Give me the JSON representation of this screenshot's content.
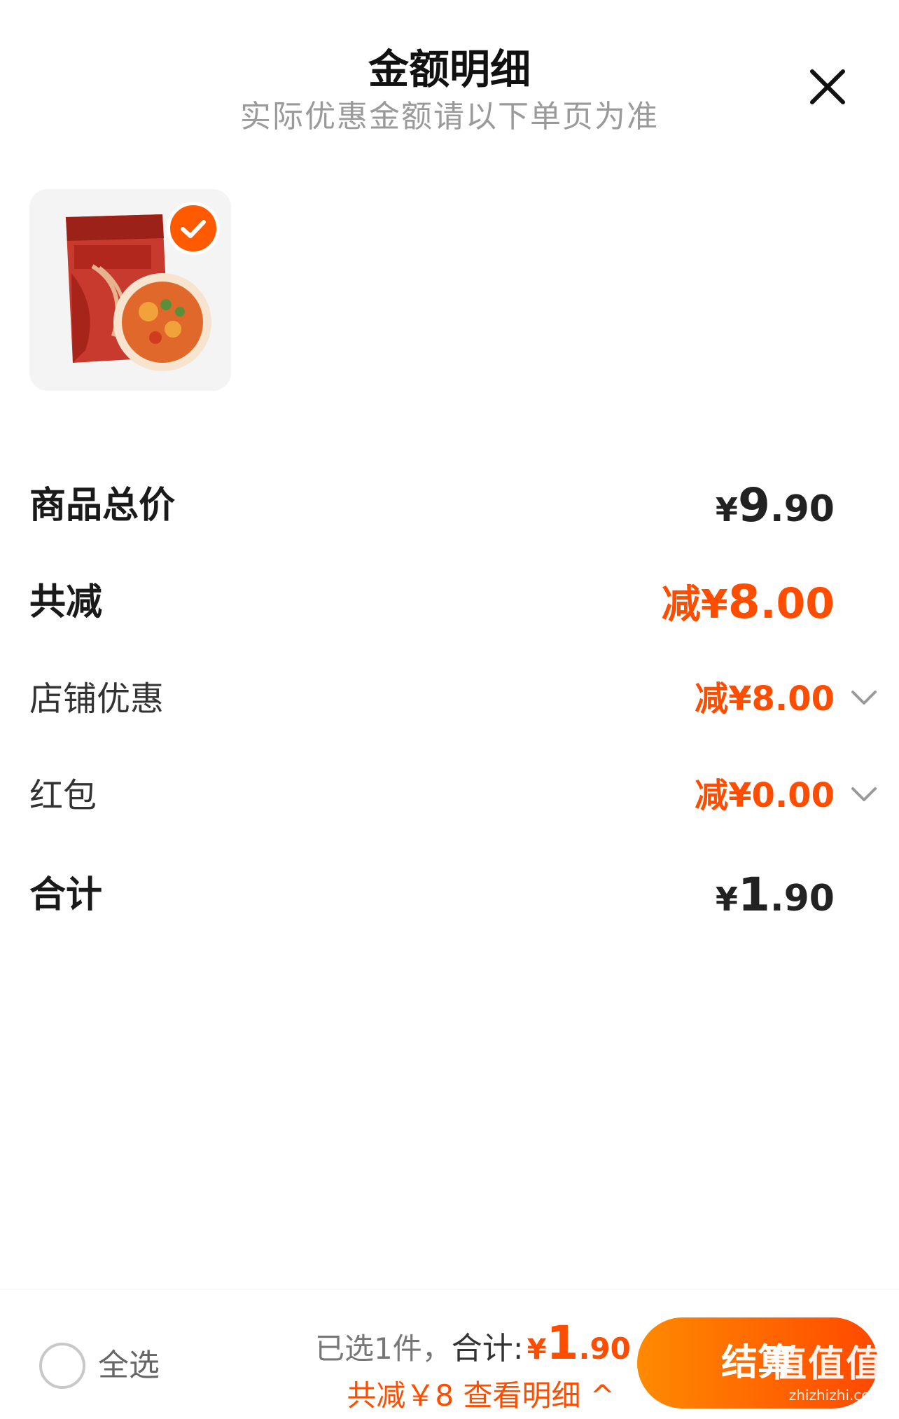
{
  "header": {
    "title": "金额明细",
    "subtitle": "实际优惠金额请以下单页为准"
  },
  "product": {
    "selected": true
  },
  "rows": {
    "total_price": {
      "label": "商品总价",
      "yen": "¥",
      "int": "9",
      "dec": ".90"
    },
    "total_discount": {
      "label": "共减",
      "prefix": "减",
      "yen": "¥",
      "int": "8",
      "dec": ".00"
    },
    "shop_coupon": {
      "label": "店铺优惠",
      "value": "减¥8.00"
    },
    "red_packet": {
      "label": "红包",
      "value": "减¥0.00"
    },
    "grand_total": {
      "label": "合计",
      "yen": "¥",
      "int": "1",
      "dec": ".90"
    }
  },
  "bottom": {
    "select_all": "全选",
    "selected_text": "已选1件，",
    "total_label": "合计:",
    "yen": "¥",
    "int": "1",
    "dec": ".90",
    "discount_text": "共减￥8 查看明细 ^",
    "checkout": "结算"
  },
  "watermark": {
    "text": "值值值",
    "url": "zhizhizhi.com"
  },
  "colors": {
    "accent": "#ff4d00",
    "checkout_start": "#ff8a00",
    "checkout_end": "#ff4800"
  },
  "icons": [
    "close-icon",
    "check-icon",
    "chevron-down-icon",
    "chevron-up-icon"
  ]
}
